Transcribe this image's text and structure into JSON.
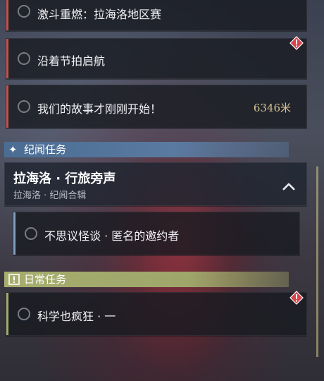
{
  "quests_top": [
    {
      "title": "激斗重燃：拉海洛地区赛"
    },
    {
      "title": "沿着节拍启航",
      "alert": true
    },
    {
      "title": "我们的故事才刚刚开始！",
      "distance": "6346米"
    }
  ],
  "section_story": {
    "title": "纪闻任务",
    "icon": "sparkle-icon"
  },
  "chronicle_group": {
    "title": "拉海洛 · 行旅旁声",
    "subtitle": "拉海洛 · 纪闻合辑",
    "toggle_icon": "chevron-up-icon"
  },
  "chronicle_quest": {
    "title": "不思议怪谈 · 匿名的邀约者"
  },
  "section_daily": {
    "title": "日常任务",
    "icon": "exclamation-box-icon"
  },
  "daily_quest": {
    "title": "科学也疯狂 · 一",
    "alert": true
  },
  "colors": {
    "red_accent": "#c4524b",
    "blue_accent": "#7d9fc0",
    "green_accent": "#a3ac6c",
    "distance": "#d7c491",
    "alert": "#d8424a"
  }
}
